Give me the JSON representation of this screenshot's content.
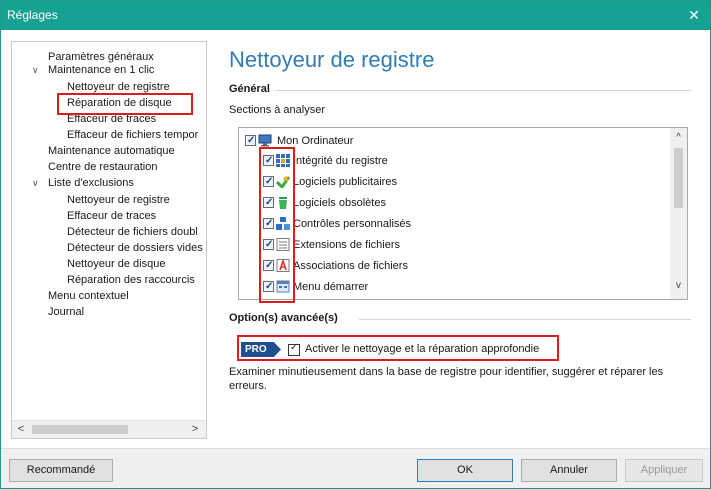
{
  "window": {
    "title": "Réglages",
    "close_glyph": "✕"
  },
  "sidebar": {
    "items": [
      {
        "label": "Paramètres généraux"
      },
      {
        "label": "Maintenance en 1 clic"
      },
      {
        "label": "Nettoyeur de registre"
      },
      {
        "label": "Réparation de disque"
      },
      {
        "label": "Effaceur de traces"
      },
      {
        "label": "Effaceur de fichiers tempor"
      },
      {
        "label": "Maintenance automatique"
      },
      {
        "label": "Centre de restauration"
      },
      {
        "label": "Liste d'exclusions"
      },
      {
        "label": "Nettoyeur de registre"
      },
      {
        "label": "Effaceur de traces"
      },
      {
        "label": "Détecteur de fichiers doubl"
      },
      {
        "label": "Détecteur de dossiers vides"
      },
      {
        "label": "Nettoyeur de disque"
      },
      {
        "label": "Réparation des raccourcis"
      },
      {
        "label": "Menu contextuel"
      },
      {
        "label": "Journal"
      }
    ],
    "scroll_left": "<",
    "scroll_right": ">"
  },
  "main": {
    "title": "Nettoyeur de registre",
    "general_heading": "Général",
    "sections_label": "Sections à analyser",
    "root_label": "Mon Ordinateur",
    "sections": [
      {
        "label": "Intégrité du registre",
        "icon": "registry-integrity-icon"
      },
      {
        "label": "Logiciels publicitaires",
        "icon": "adware-icon"
      },
      {
        "label": "Logiciels obsolètes",
        "icon": "obsolete-software-icon"
      },
      {
        "label": "Contrôles personnalisés",
        "icon": "custom-controls-icon"
      },
      {
        "label": "Extensions de fichiers",
        "icon": "file-extensions-icon"
      },
      {
        "label": "Associations de fichiers",
        "icon": "file-associations-icon"
      },
      {
        "label": "Menu démarrer",
        "icon": "start-menu-icon"
      }
    ],
    "scroll_up": "^",
    "scroll_down": "v",
    "advanced_heading": "Option(s) avancée(s)",
    "pro_badge": "PRO",
    "deep_clean_label": "Activer le nettoyage et la réparation approfondie",
    "description": "Examiner minutieusement dans la base de registre pour identifier, suggérer et réparer les erreurs."
  },
  "footer": {
    "recommended": "Recommandé",
    "ok": "OK",
    "cancel": "Annuler",
    "apply": "Appliquer"
  },
  "colors": {
    "titlebar": "#16a292",
    "accent": "#2f7db8",
    "highlight": "#d81e1e",
    "pro": "#1f4f8e"
  }
}
